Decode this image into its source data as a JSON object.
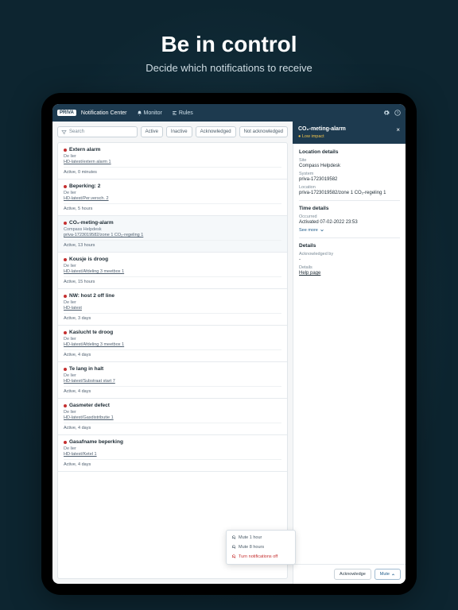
{
  "headline": "Be in control",
  "subhead": "Decide which notifications to receive",
  "topbar": {
    "logo": "PRIVA",
    "title": "Notification Center",
    "nav": [
      {
        "label": "Monitor"
      },
      {
        "label": "Rules"
      }
    ]
  },
  "search": {
    "placeholder": "Search"
  },
  "filters": {
    "active": "Active",
    "inactive": "Inactive",
    "ack": "Acknowledged",
    "nack": "Not acknowledged"
  },
  "items": [
    {
      "title": "Extern alarm",
      "sub": "De lier",
      "link": "HD-latest/extern alarm 1",
      "status": "Active, 0 minutes",
      "selected": false
    },
    {
      "title": "Beperking: 2",
      "sub": "De lier",
      "link": "HD-latest/Per.versch. 2",
      "status": "Active, 5 hours",
      "selected": false
    },
    {
      "title": "CO₂-meting-alarm",
      "sub": "Compass Helpdesk",
      "link": "priva-1723019582/zone 1 CO₂-regeling 1",
      "status": "Active, 13 hours",
      "selected": true
    },
    {
      "title": "Kousje is droog",
      "sub": "De lier",
      "link": "HD-latest/Afdeling 3 meetbox 1",
      "status": "Active, 15 hours",
      "selected": false
    },
    {
      "title": "NW: host 2 off line",
      "sub": "De lier",
      "link": "HD-latest",
      "status": "Active, 3 days",
      "selected": false
    },
    {
      "title": "Kaslucht te droog",
      "sub": "De lier",
      "link": "HD-latest/Afdeling 3 meetbox 1",
      "status": "Active, 4 days",
      "selected": false
    },
    {
      "title": "Te lang in halt",
      "sub": "De lier",
      "link": "HD-latest/Substraat start 7",
      "status": "Active, 4 days",
      "selected": false
    },
    {
      "title": "Gasmeter defect",
      "sub": "De lier",
      "link": "HD-latest/Gasdistributie 1",
      "status": "Active, 4 days",
      "selected": false
    },
    {
      "title": "Gasafname beperking",
      "sub": "De lier",
      "link": "HD-latest/Ketel 1",
      "status": "Active, 4 days",
      "selected": false
    }
  ],
  "panel": {
    "title": "CO₂-meting-alarm",
    "impact": "Low impact",
    "loc_title": "Location details",
    "site_label": "Site",
    "site": "Compass Helpdesk",
    "system_label": "System",
    "system": "priva-1723019582",
    "location_label": "Location",
    "location": "priva-1723019582/zone 1 CO₂-regeling 1",
    "time_title": "Time details",
    "occurred_label": "Occurred",
    "occurred": "Activated 07-02-2022 23:53",
    "see_more": "See more",
    "details_title": "Details",
    "ack_by_label": "Acknowledged by",
    "ack_by": "-",
    "details_label": "Details",
    "details_link": "Help page"
  },
  "popup": {
    "mute1": "Mute 1 hour",
    "mute8": "Mute 8 hours",
    "off": "Turn notifications off"
  },
  "actions": {
    "ack": "Acknowledge",
    "mute": "Mute"
  }
}
